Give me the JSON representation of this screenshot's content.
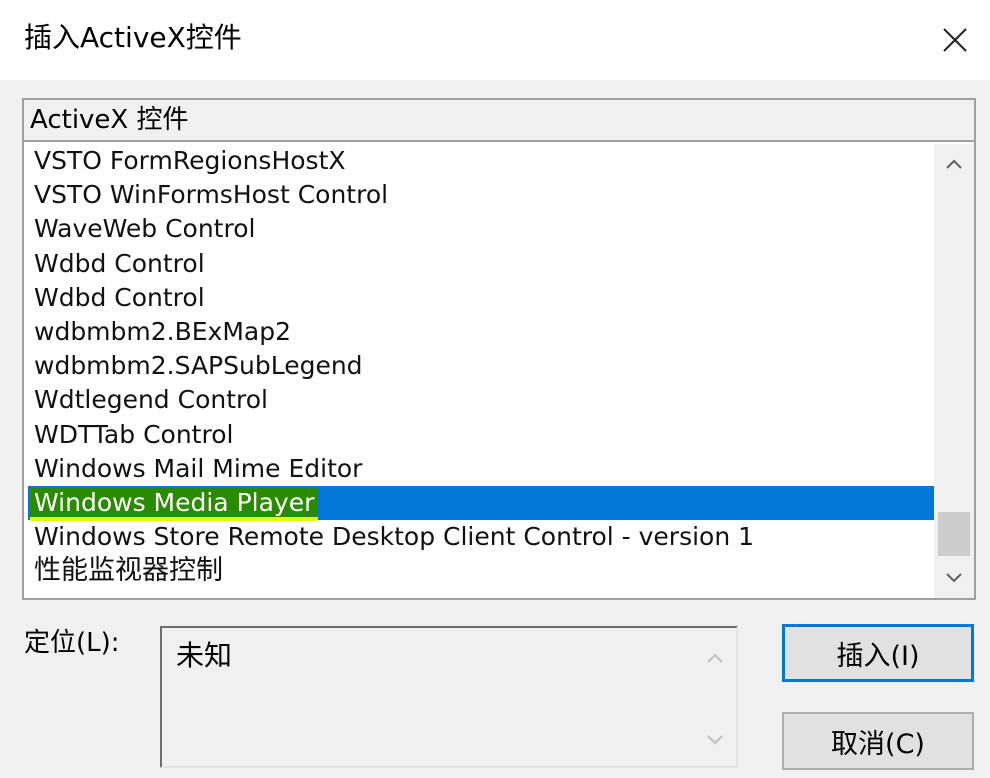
{
  "window": {
    "title": "插入ActiveX控件",
    "close_icon": "close-icon"
  },
  "list": {
    "header": "ActiveX 控件",
    "items": [
      "VSTO FormRegionsHostX",
      "VSTO WinFormsHost Control",
      "WaveWeb Control",
      "Wdbd Control",
      "Wdbd Control",
      "wdbmbm2.BExMap2",
      "wdbmbm2.SAPSubLegend",
      "Wdtlegend Control",
      "WDTTab Control",
      "Windows Mail Mime Editor",
      "Windows Media Player",
      "Windows Store Remote Desktop Client Control - version 1",
      "性能监视器控制"
    ],
    "selected_index": 10,
    "scroll_up_icon": "chevron-up-icon",
    "scroll_down_icon": "chevron-down-icon"
  },
  "location": {
    "label": "定位(L):",
    "value": "未知"
  },
  "buttons": {
    "insert": "插入(I)",
    "cancel": "取消(C)"
  },
  "colors": {
    "selection": "#0078d7",
    "highlight": "#2a8a00",
    "highlight_underline": "#e6ff00"
  }
}
